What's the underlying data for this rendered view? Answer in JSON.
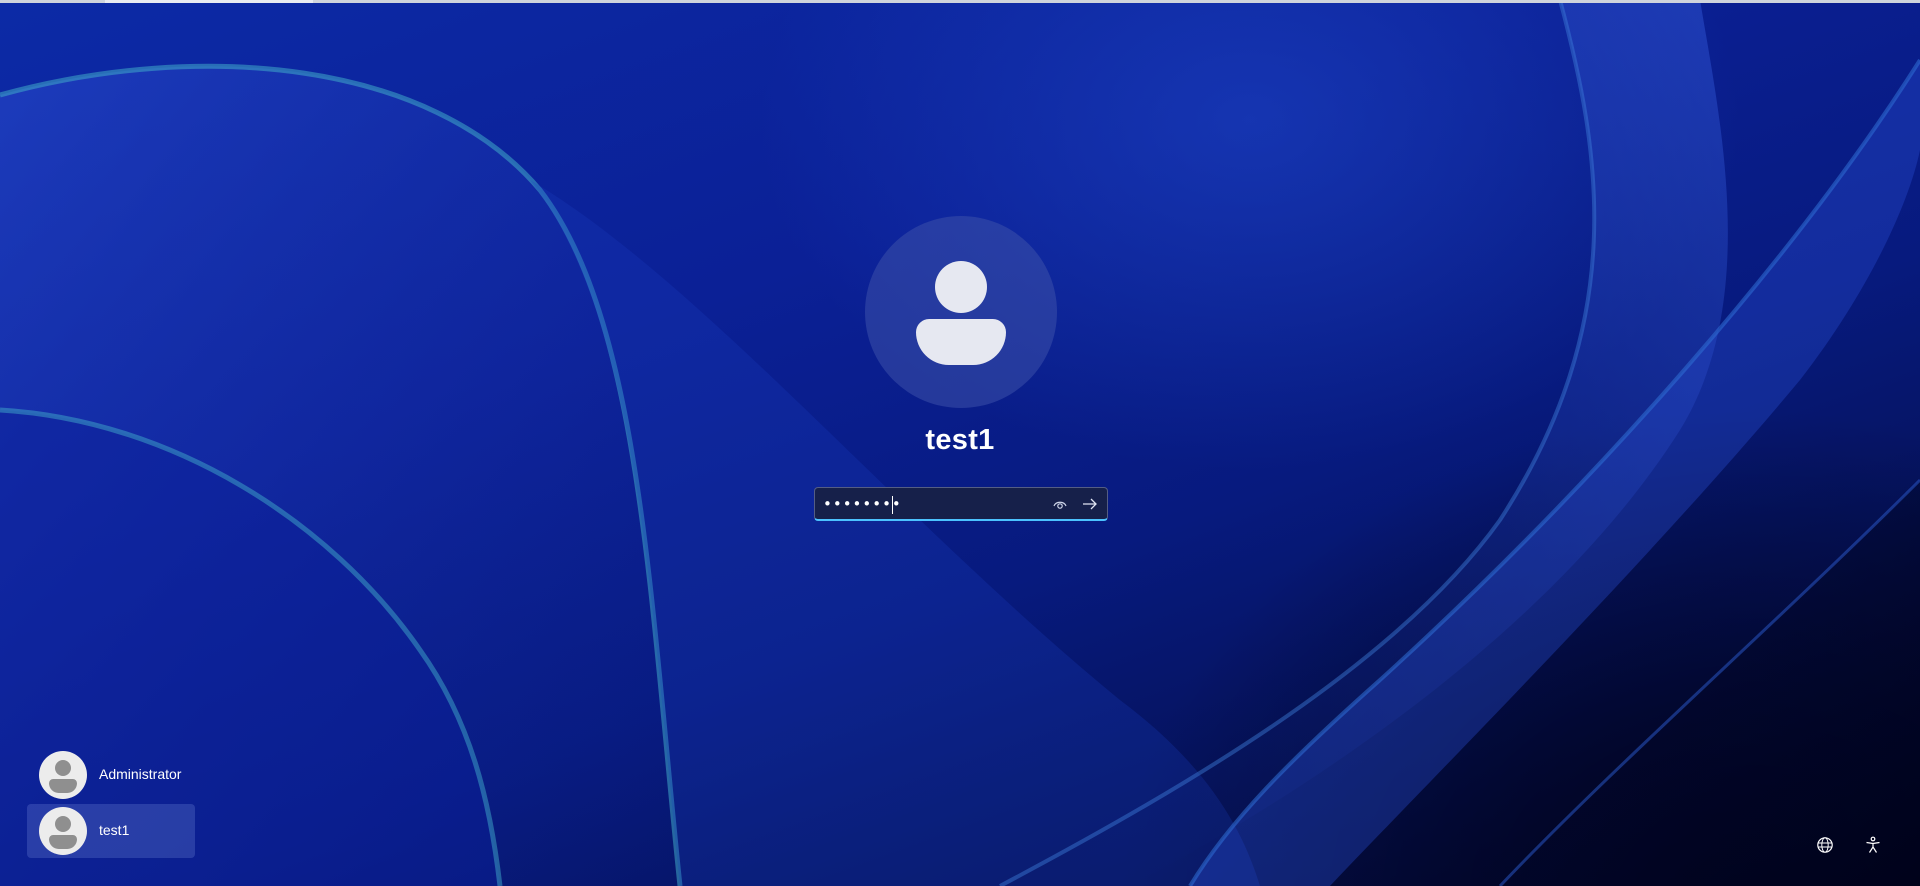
{
  "login": {
    "username": "test1",
    "password_mask": "••••••••"
  },
  "user_list": [
    {
      "name": "Administrator",
      "selected": false
    },
    {
      "name": "test1",
      "selected": true
    }
  ],
  "icons": {
    "user_avatar": "person-icon",
    "reveal": "eye-icon",
    "submit": "arrow-right-icon",
    "network": "globe-icon",
    "accessibility": "accessibility-icon"
  },
  "colors": {
    "accent": "#4cc2ff",
    "background": "#0b2096",
    "input_bg": "#16204a"
  }
}
